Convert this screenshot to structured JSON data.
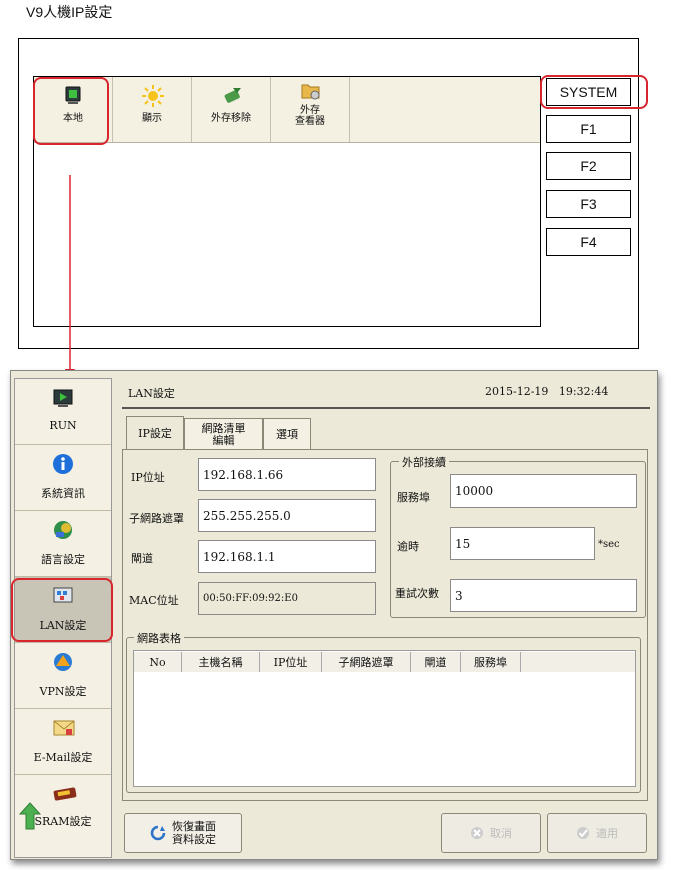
{
  "title": "V9人機IP設定",
  "top_panel": {
    "icons": [
      {
        "label": "本地",
        "icon": "monitor-icon"
      },
      {
        "label": "顯示",
        "icon": "sun-icon"
      },
      {
        "label": "外存移除",
        "icon": "eject-icon"
      },
      {
        "label_line1": "外存",
        "label_line2": "查看器",
        "icon": "folder-icon"
      }
    ],
    "fkeys": [
      "SYSTEM",
      "F1",
      "F2",
      "F3",
      "F4"
    ]
  },
  "sidebar": {
    "items": [
      {
        "label": "RUN",
        "icon": "run-icon"
      },
      {
        "label": "系統資訊",
        "icon": "info-icon"
      },
      {
        "label": "語言設定",
        "icon": "language-icon"
      },
      {
        "label": "LAN設定",
        "icon": "lan-icon"
      },
      {
        "label": "VPN設定",
        "icon": "vpn-icon"
      },
      {
        "label": "E-Mail設定",
        "icon": "email-icon"
      },
      {
        "label": "SRAM設定",
        "icon": "sram-icon"
      }
    ]
  },
  "header": {
    "title": "LAN設定",
    "date": "2015-12-19",
    "time": "19:32:44"
  },
  "tabs": [
    {
      "label": "IP設定"
    },
    {
      "label_line1": "網路清單",
      "label_line2": "編輯"
    },
    {
      "label": "選項"
    }
  ],
  "ip_settings": {
    "ip_label": "IP位址",
    "ip_value": "192.168.1.66",
    "subnet_label": "子網路遮罩",
    "subnet_value": "255.255.255.0",
    "gateway_label": "閘道",
    "gateway_value": "192.168.1.1",
    "mac_label": "MAC位址",
    "mac_value": "00:50:FF:09:92:E0"
  },
  "external": {
    "legend": "外部接續",
    "port_label": "服務埠",
    "port_value": "10000",
    "timeout_label": "逾時",
    "timeout_value": "15",
    "timeout_unit": "*sec",
    "retry_label": "重試次數",
    "retry_value": "3"
  },
  "network_table": {
    "legend": "網路表格",
    "columns": [
      "No",
      "主機名稱",
      "IP位址",
      "子網路遮罩",
      "閘道",
      "服務埠"
    ]
  },
  "buttons": {
    "restore_line1": "恢復畫面",
    "restore_line2": "資料設定",
    "cancel": "取消",
    "apply": "適用"
  },
  "colors": {
    "highlight": "#d9262e",
    "panel_bg": "#ece9d8",
    "bar_bg": "#f4f0e2"
  }
}
